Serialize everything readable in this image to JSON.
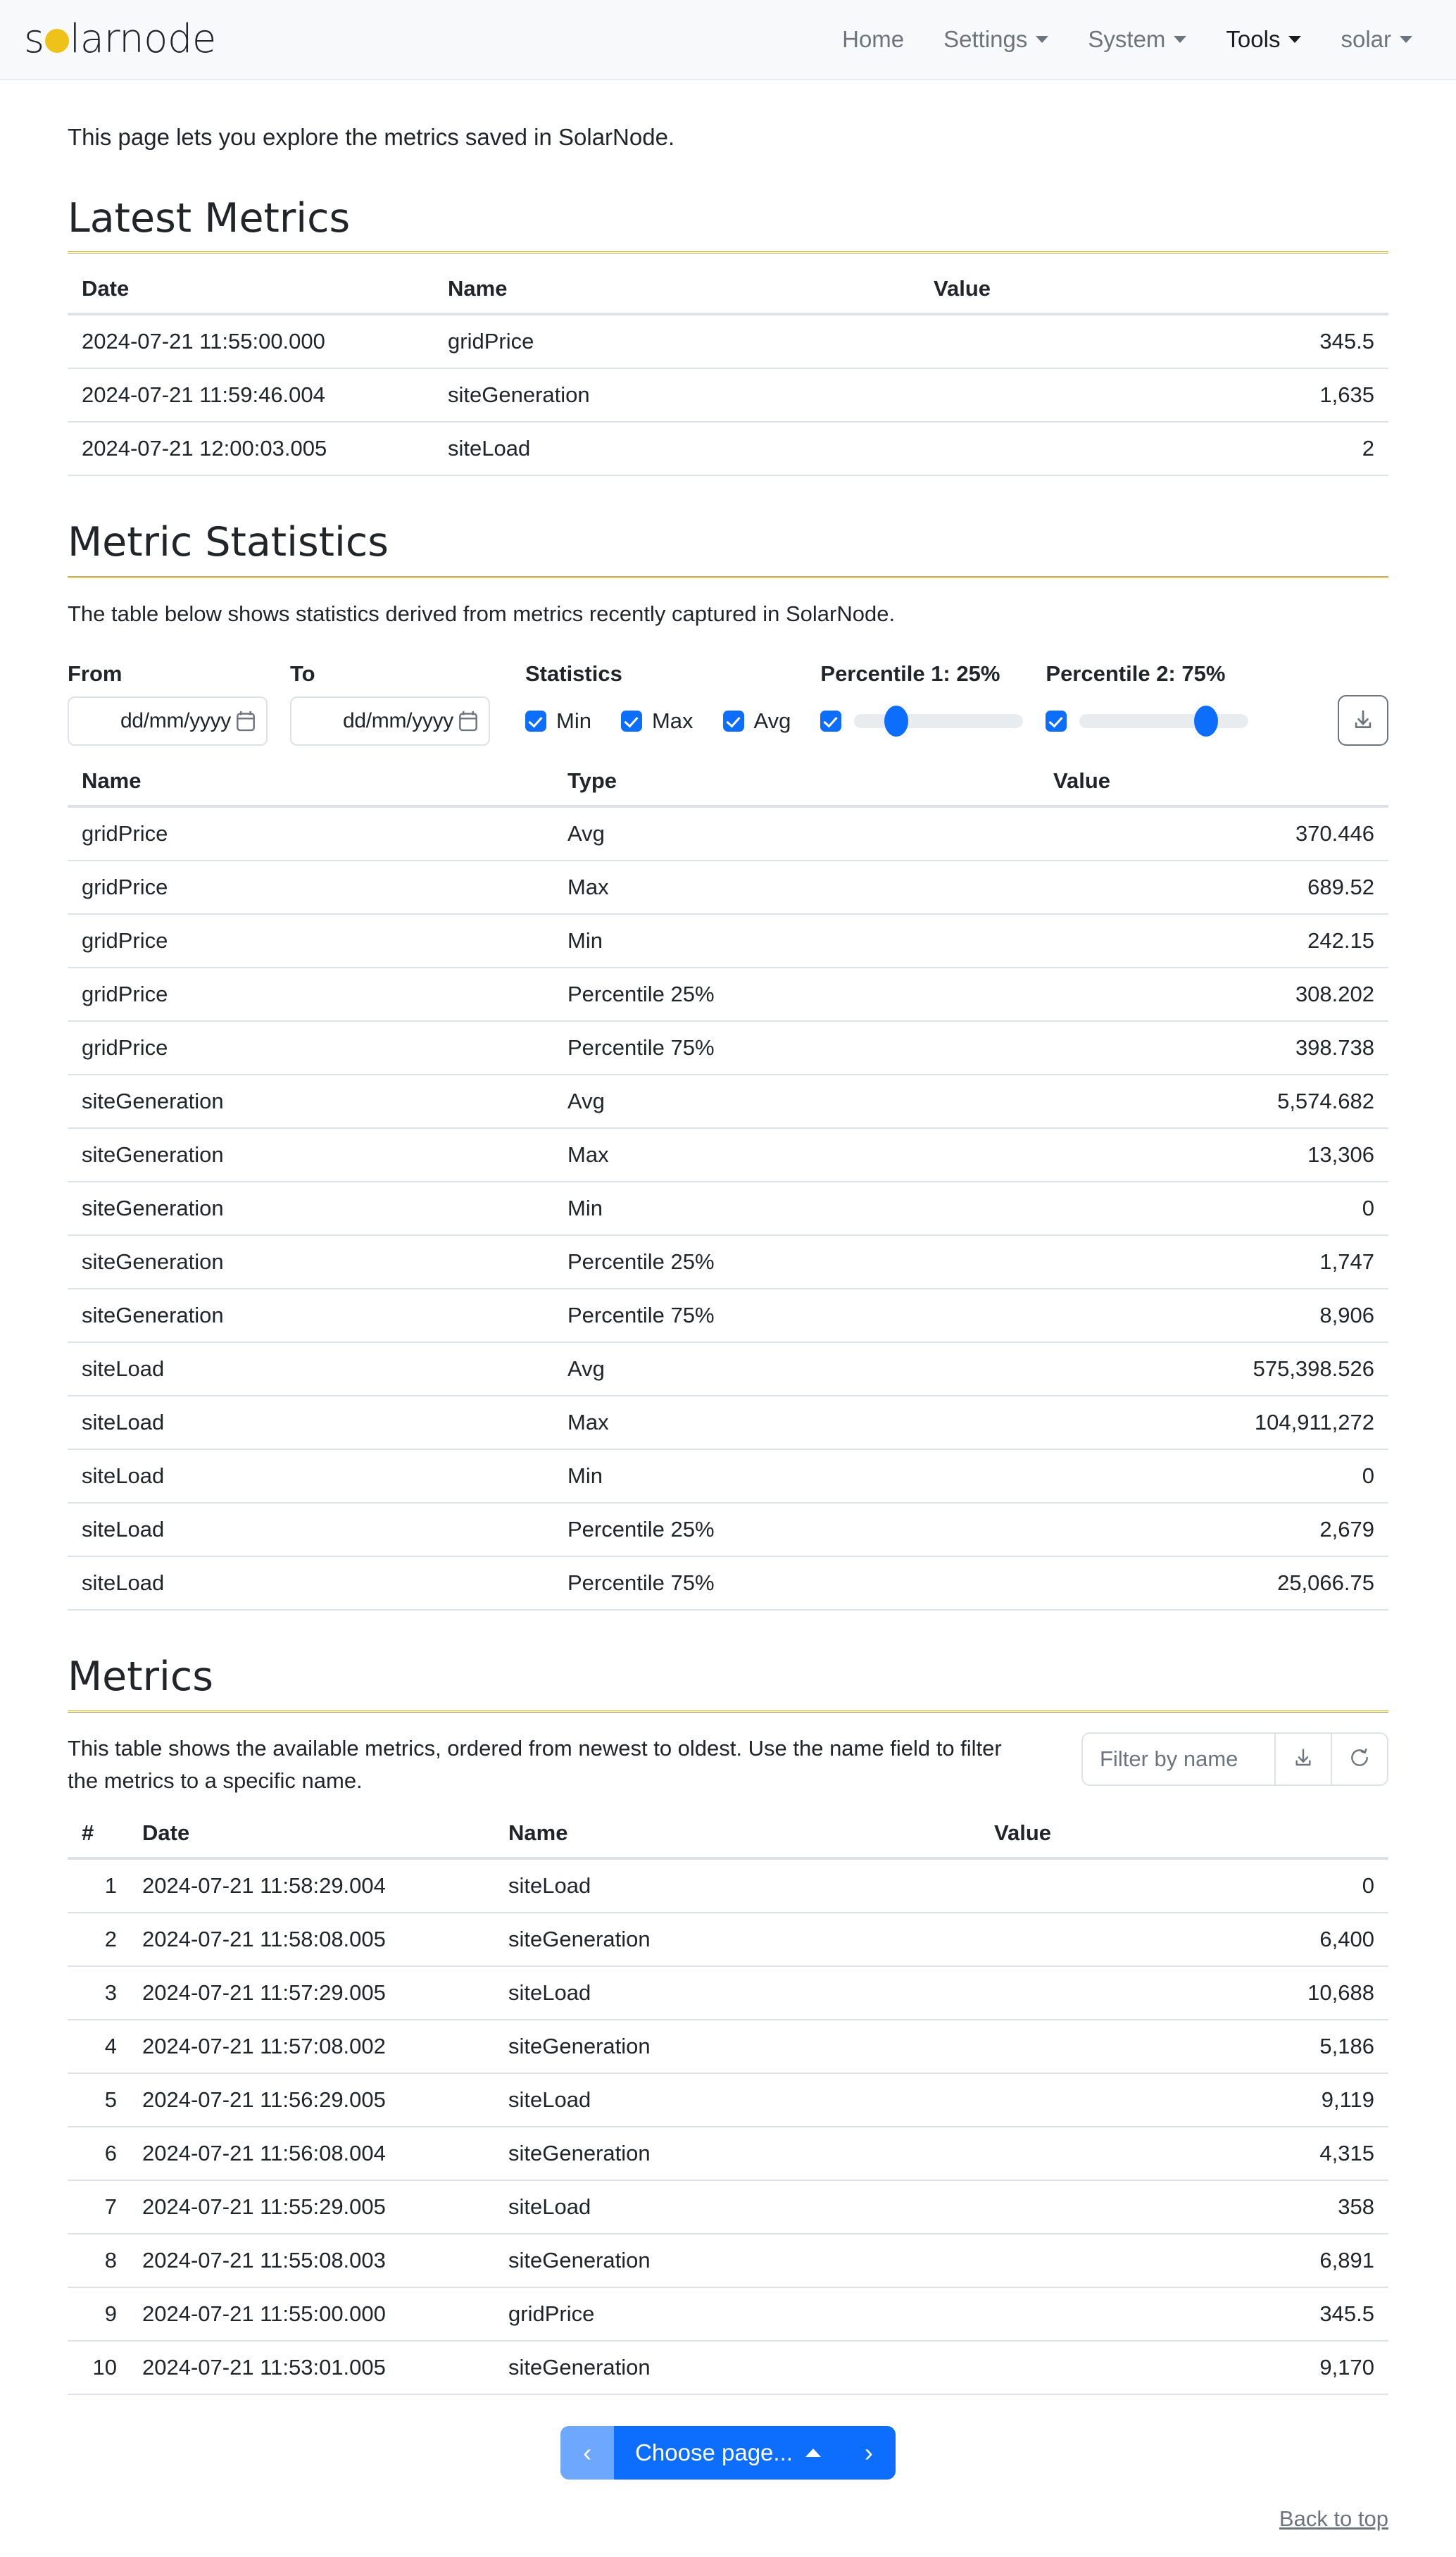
{
  "navbar": {
    "brand_before": "s",
    "brand_sun": "o",
    "brand_after": "larnode",
    "items": [
      {
        "label": "Home",
        "has_caret": false,
        "active": false
      },
      {
        "label": "Settings",
        "has_caret": true,
        "active": false
      },
      {
        "label": "System",
        "has_caret": true,
        "active": false
      },
      {
        "label": "Tools",
        "has_caret": true,
        "active": true
      },
      {
        "label": "solar",
        "has_caret": true,
        "active": false
      }
    ]
  },
  "page": {
    "intro": "This page lets you explore the metrics saved in SolarNode."
  },
  "latest_metrics": {
    "title": "Latest Metrics",
    "columns": [
      "Date",
      "Name",
      "Value"
    ],
    "rows": [
      {
        "date": "2024-07-21 11:55:00.000",
        "name": "gridPrice",
        "value": "345.5"
      },
      {
        "date": "2024-07-21 11:59:46.004",
        "name": "siteGeneration",
        "value": "1,635"
      },
      {
        "date": "2024-07-21 12:00:03.005",
        "name": "siteLoad",
        "value": "2"
      }
    ]
  },
  "metric_statistics": {
    "title": "Metric Statistics",
    "lead": "The table below shows statistics derived from metrics recently captured in SolarNode.",
    "form": {
      "from_label": "From",
      "from_value": "dd/mm/yyyy",
      "to_label": "To",
      "to_value": "dd/mm/yyyy",
      "statistics_label": "Statistics",
      "checks": [
        {
          "label": "Min",
          "checked": true
        },
        {
          "label": "Max",
          "checked": true
        },
        {
          "label": "Avg",
          "checked": true
        }
      ],
      "percentile1_label": "Percentile 1: 25%",
      "percentile1_value": 25,
      "percentile1_checked": true,
      "percentile2_label": "Percentile 2: 75%",
      "percentile2_value": 75,
      "percentile2_checked": true,
      "download_icon": "download-icon"
    },
    "columns": [
      "Name",
      "Type",
      "Value"
    ],
    "rows": [
      {
        "name": "gridPrice",
        "type": "Avg",
        "value": "370.446"
      },
      {
        "name": "gridPrice",
        "type": "Max",
        "value": "689.52"
      },
      {
        "name": "gridPrice",
        "type": "Min",
        "value": "242.15"
      },
      {
        "name": "gridPrice",
        "type": "Percentile 25%",
        "value": "308.202"
      },
      {
        "name": "gridPrice",
        "type": "Percentile 75%",
        "value": "398.738"
      },
      {
        "name": "siteGeneration",
        "type": "Avg",
        "value": "5,574.682"
      },
      {
        "name": "siteGeneration",
        "type": "Max",
        "value": "13,306"
      },
      {
        "name": "siteGeneration",
        "type": "Min",
        "value": "0"
      },
      {
        "name": "siteGeneration",
        "type": "Percentile 25%",
        "value": "1,747"
      },
      {
        "name": "siteGeneration",
        "type": "Percentile 75%",
        "value": "8,906"
      },
      {
        "name": "siteLoad",
        "type": "Avg",
        "value": "575,398.526"
      },
      {
        "name": "siteLoad",
        "type": "Max",
        "value": "104,911,272"
      },
      {
        "name": "siteLoad",
        "type": "Min",
        "value": "0"
      },
      {
        "name": "siteLoad",
        "type": "Percentile 25%",
        "value": "2,679"
      },
      {
        "name": "siteLoad",
        "type": "Percentile 75%",
        "value": "25,066.75"
      }
    ]
  },
  "metrics": {
    "title": "Metrics",
    "lead": "This table shows the available metrics, ordered from newest to oldest. Use the name field to filter the metrics to a specific name.",
    "filter_placeholder": "Filter by name",
    "filter_value": "",
    "download_icon": "download-icon",
    "refresh_icon": "refresh-icon",
    "columns": [
      "#",
      "Date",
      "Name",
      "Value"
    ],
    "rows": [
      {
        "idx": "1",
        "date": "2024-07-21 11:58:29.004",
        "name": "siteLoad",
        "value": "0"
      },
      {
        "idx": "2",
        "date": "2024-07-21 11:58:08.005",
        "name": "siteGeneration",
        "value": "6,400"
      },
      {
        "idx": "3",
        "date": "2024-07-21 11:57:29.005",
        "name": "siteLoad",
        "value": "10,688"
      },
      {
        "idx": "4",
        "date": "2024-07-21 11:57:08.002",
        "name": "siteGeneration",
        "value": "5,186"
      },
      {
        "idx": "5",
        "date": "2024-07-21 11:56:29.005",
        "name": "siteLoad",
        "value": "9,119"
      },
      {
        "idx": "6",
        "date": "2024-07-21 11:56:08.004",
        "name": "siteGeneration",
        "value": "4,315"
      },
      {
        "idx": "7",
        "date": "2024-07-21 11:55:29.005",
        "name": "siteLoad",
        "value": "358"
      },
      {
        "idx": "8",
        "date": "2024-07-21 11:55:08.003",
        "name": "siteGeneration",
        "value": "6,891"
      },
      {
        "idx": "9",
        "date": "2024-07-21 11:55:00.000",
        "name": "gridPrice",
        "value": "345.5"
      },
      {
        "idx": "10",
        "date": "2024-07-21 11:53:01.005",
        "name": "siteGeneration",
        "value": "9,170"
      }
    ]
  },
  "pagination": {
    "prev_label": "‹",
    "choose_label": "Choose page...",
    "next_label": "›"
  },
  "footer": {
    "back_to_top": "Back to top"
  },
  "colors": {
    "accent_gold": "#c9a227",
    "brand_sun": "#eec218",
    "primary_blue": "#0d6efd",
    "primary_blue_muted": "#6ea8fe",
    "muted_text": "#6c757d",
    "border": "#dee2e6",
    "navbar_bg": "#f8f9fa"
  }
}
